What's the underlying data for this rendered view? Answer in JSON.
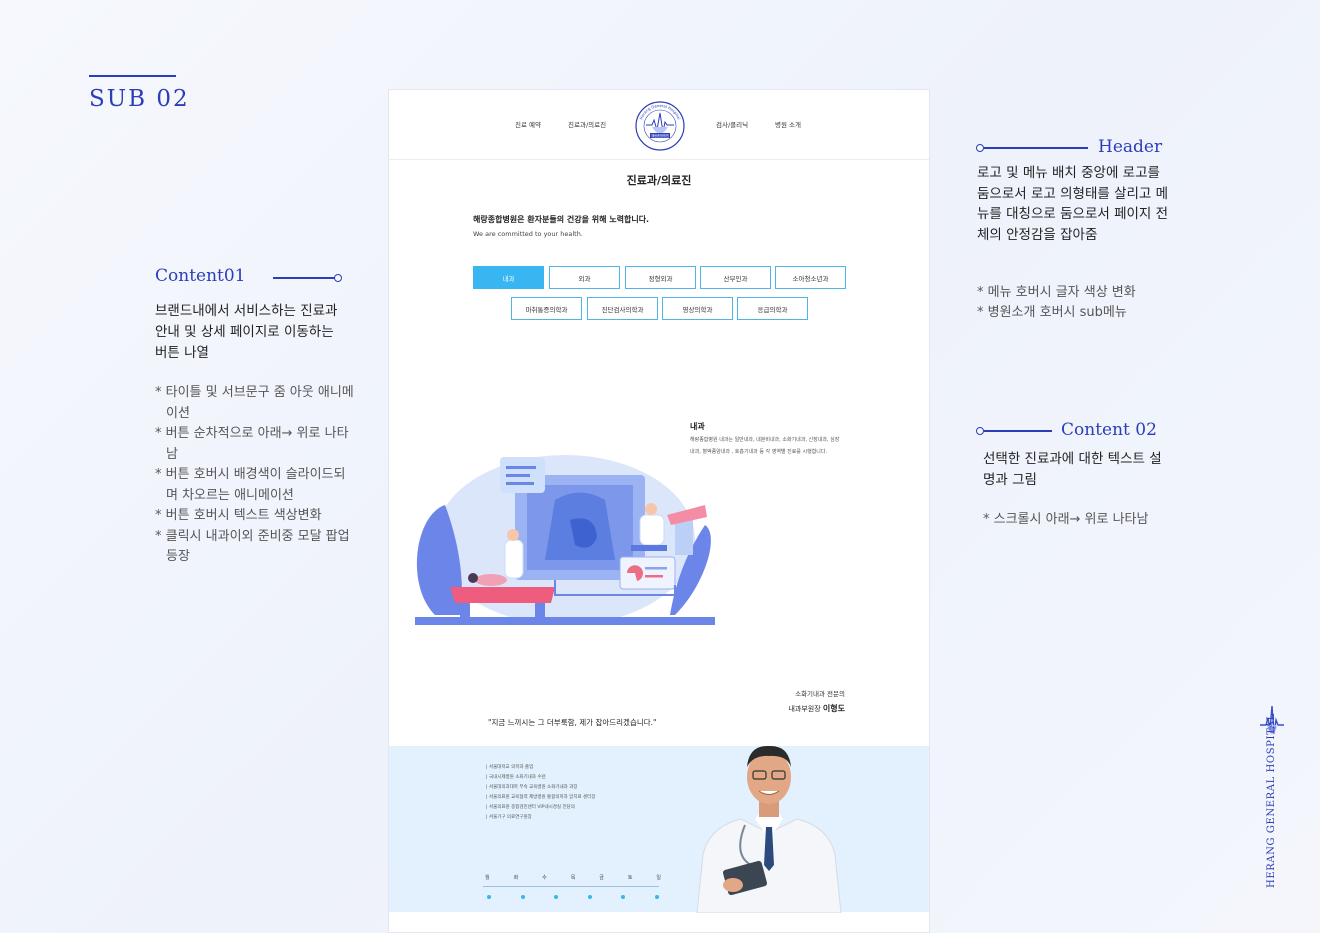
{
  "section": {
    "label": "SUB 02"
  },
  "content01": {
    "title": "Content01",
    "description": "브랜드내에서 서비스하는 진료과 안내 및 상세 페이지로 이동하는 버튼 나열",
    "notes": [
      "* 타이틀 및 서브문구 줌 아웃 애니메이션",
      "* 버튼 순차적으로 아래→ 위로 나타남",
      "* 버튼 호버시 배경색이 슬라이드되며 차오르는 애니메이션",
      "* 버튼 호버시 텍스트 색상변화",
      "* 클릭시 내과이외 준비중 모달 팝업 등장"
    ]
  },
  "header_note": {
    "title": "Header",
    "description": "로고 및 메뉴 배치 중앙에 로고를 둠으로서 로고 의형태를 살리고 메뉴를 대칭으로 둠으로서 페이지 전체의 안정감을 잡아줌",
    "notes": [
      "* 메뉴 호버시 글자 색상 변화",
      "* 병원소개 호버시 sub메뉴"
    ]
  },
  "content02": {
    "title": "Content 02",
    "description": "선택한 진료과에 대한 텍스트 설명과 그림",
    "notes": [
      "* 스크롤시 아래→ 위로  나타남"
    ]
  },
  "brand_vertical": "HERANG GENERAL HOSPITAL",
  "mockup": {
    "nav": [
      "진료 예약",
      "진료과/의료진",
      "검사/클리닉",
      "병원 소개"
    ],
    "logo": {
      "arc_top": "Herang General Hospital",
      "center": "해랑종합병원"
    },
    "page_title": "진료과/의료진",
    "intro": "해랑종합병원은 환자분들의 건강을 위해 노력합니다.",
    "intro_en": "We are committed to your health.",
    "departments_row1": [
      "내과",
      "외과",
      "정형외과",
      "산부인과",
      "소아청소년과"
    ],
    "departments_row2": [
      "마취통증의학과",
      "진단검사의학과",
      "영상의학과",
      "응급의학과"
    ],
    "active_department": "내과",
    "info_title": "내과",
    "info_text": "해랑종합병원 내과는 일반내과, 내분비내과, 소화기내과, 신장내과, 심장내과, 혈액종양내과 , 호흡기내과 등 각 영역별 진료를 시행합니다.",
    "quote": "\"지금 느끼시는 그 더부룩함, 제가 잡아드리겠습니다.\"",
    "doctor_role": "소화기내과 전문의",
    "doctor_position": "내과부원장",
    "doctor_name": "이형도",
    "career": [
      "| 서울대학교 의학과 졸업",
      "| 국내시제병원 소화기내과 수련",
      "| 서울대의과대학 부속 교육병원 소화기내과 과장",
      "| 서울의료원 교육협력 제방병원 통합의학과 암치료 센터장",
      "| 서울의료원 종합검진센터 VIP내시경실 전담의",
      "| 서울기구 의료연구원장"
    ],
    "days": [
      "월",
      "화",
      "수",
      "목",
      "금",
      "토",
      "일"
    ]
  },
  "colors": {
    "accent": "#2b3db8",
    "button_active": "#38b6f2",
    "band": "#e2f1fd"
  }
}
